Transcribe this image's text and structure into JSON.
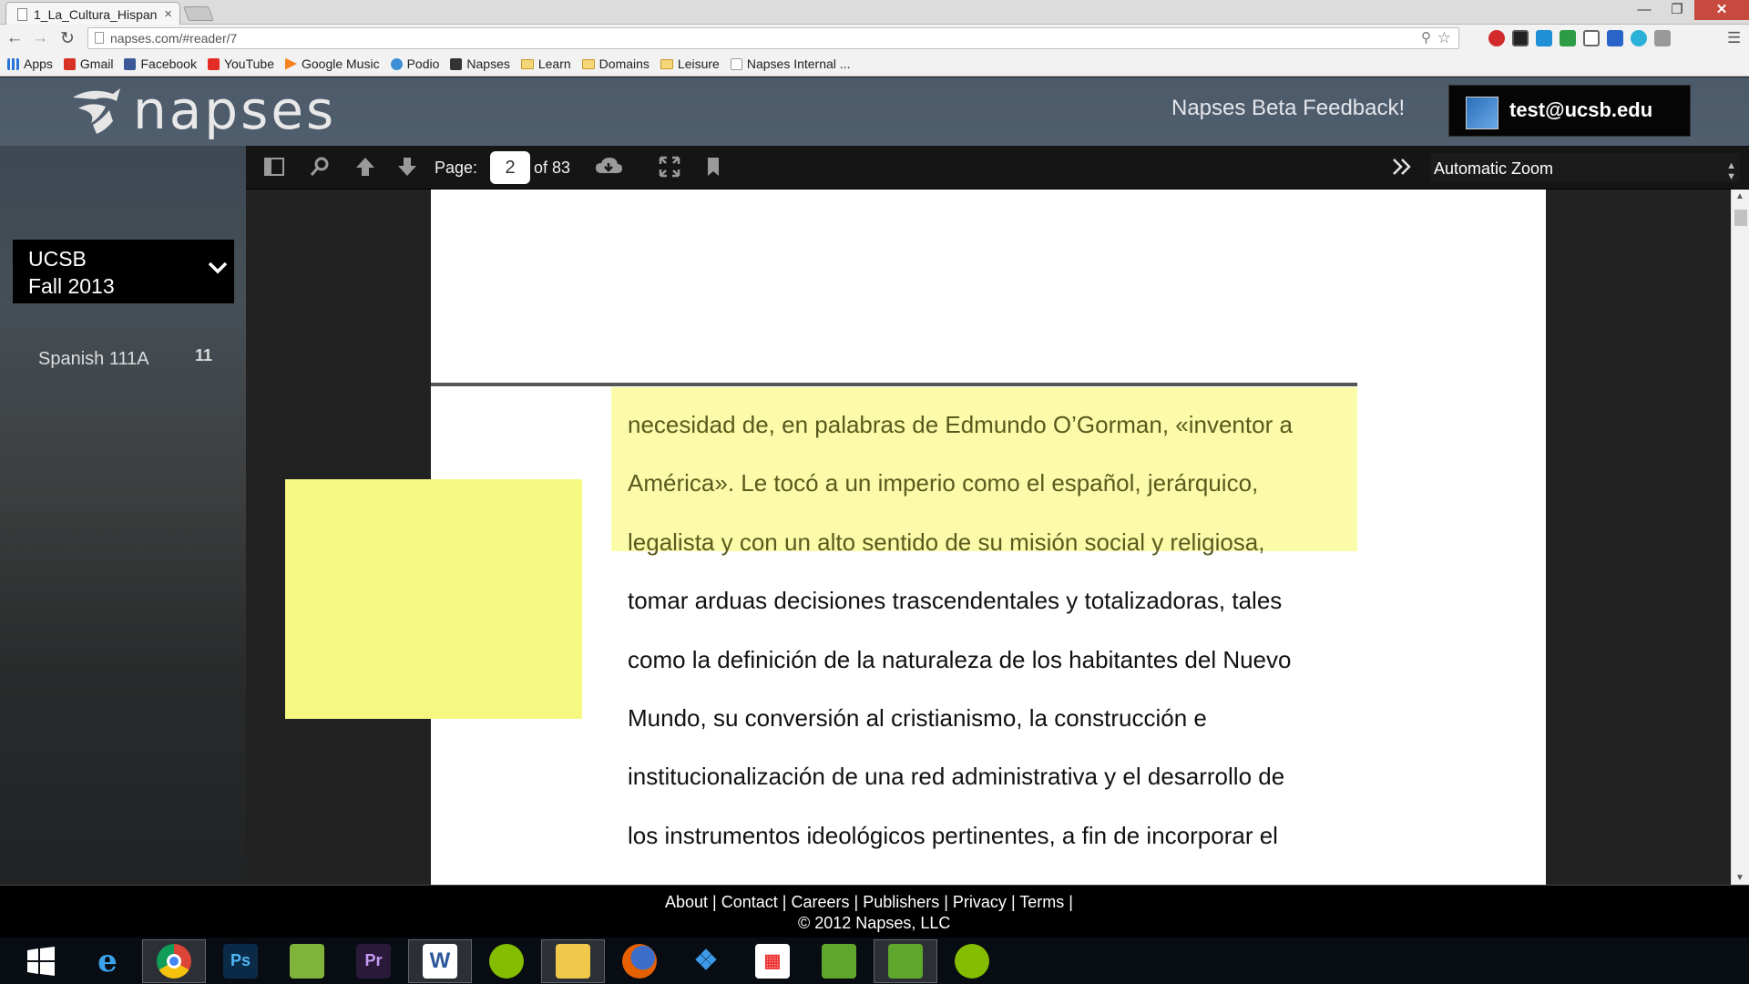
{
  "browser": {
    "tab_title": "1_La_Cultura_Hispan",
    "tab_close": "×",
    "url": "napses.com/#reader/7",
    "bookmarks": [
      "Apps",
      "Gmail",
      "Facebook",
      "YouTube",
      "Google Music",
      "Podio",
      "Napses",
      "Learn",
      "Domains",
      "Leisure",
      "Napses Internal ..."
    ]
  },
  "header": {
    "logo_text": "napses",
    "feedback": "Napses Beta Feedback!",
    "user_email": "test@ucsb.edu"
  },
  "sidebar": {
    "term_line1": "UCSB",
    "term_line2": "Fall 2013",
    "course": "Spanish 111A",
    "course_badge": "11"
  },
  "pdf_toolbar": {
    "page_label": "Page:",
    "page_value": "2",
    "page_of": "of 83",
    "zoom": "Automatic Zoom"
  },
  "document": {
    "lines": [
      "necesidad de, en palabras de Edmundo O’Gorman, «inventor a",
      "América». Le tocó a un imperio como el español, jerárquico,",
      "legalista y con un alto sentido de su misión social y religiosa,",
      "tomar arduas decisiones trascendentales y totalizadoras, tales",
      "como la definición de la naturaleza de los habitantes del Nuevo",
      "Mundo, su conversión al cristianismo, la construcción e",
      "institucionalización de una red administrativa y el desarrollo de",
      "los instrumentos ideológicos pertinentes, a fin de incorporar el"
    ],
    "highlight_color": "#fbfba9",
    "note_color": "#f5f982"
  },
  "footer": {
    "links": [
      "About",
      "Contact",
      "Careers",
      "Publishers",
      "Privacy",
      "Terms"
    ],
    "copyright": "© 2012 Napses, LLC"
  },
  "taskbar": {
    "apps": [
      "start",
      "internet-explorer",
      "chrome",
      "photoshop",
      "notepad",
      "premiere",
      "word",
      "spotify",
      "file-explorer",
      "firefox",
      "dropbox",
      "apps-grid",
      "evernote",
      "evernote",
      "spotify"
    ]
  }
}
